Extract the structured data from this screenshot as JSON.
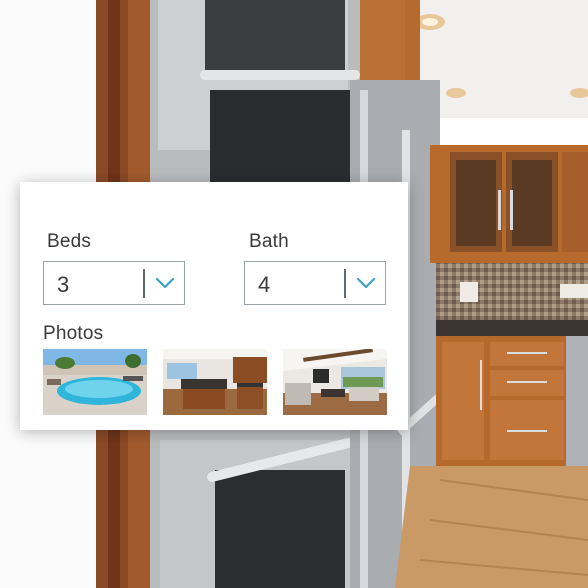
{
  "filters": {
    "beds": {
      "label": "Beds",
      "value": "3"
    },
    "bath": {
      "label": "Bath",
      "value": "4"
    }
  },
  "photos": {
    "label": "Photos",
    "items": [
      "pool",
      "kitchen",
      "living-room"
    ]
  },
  "icons": {
    "dropdown": "chevron-down-icon"
  },
  "colors": {
    "accent": "#3aa3c7",
    "border": "#9aa3a8",
    "text": "#3a3a3a"
  }
}
